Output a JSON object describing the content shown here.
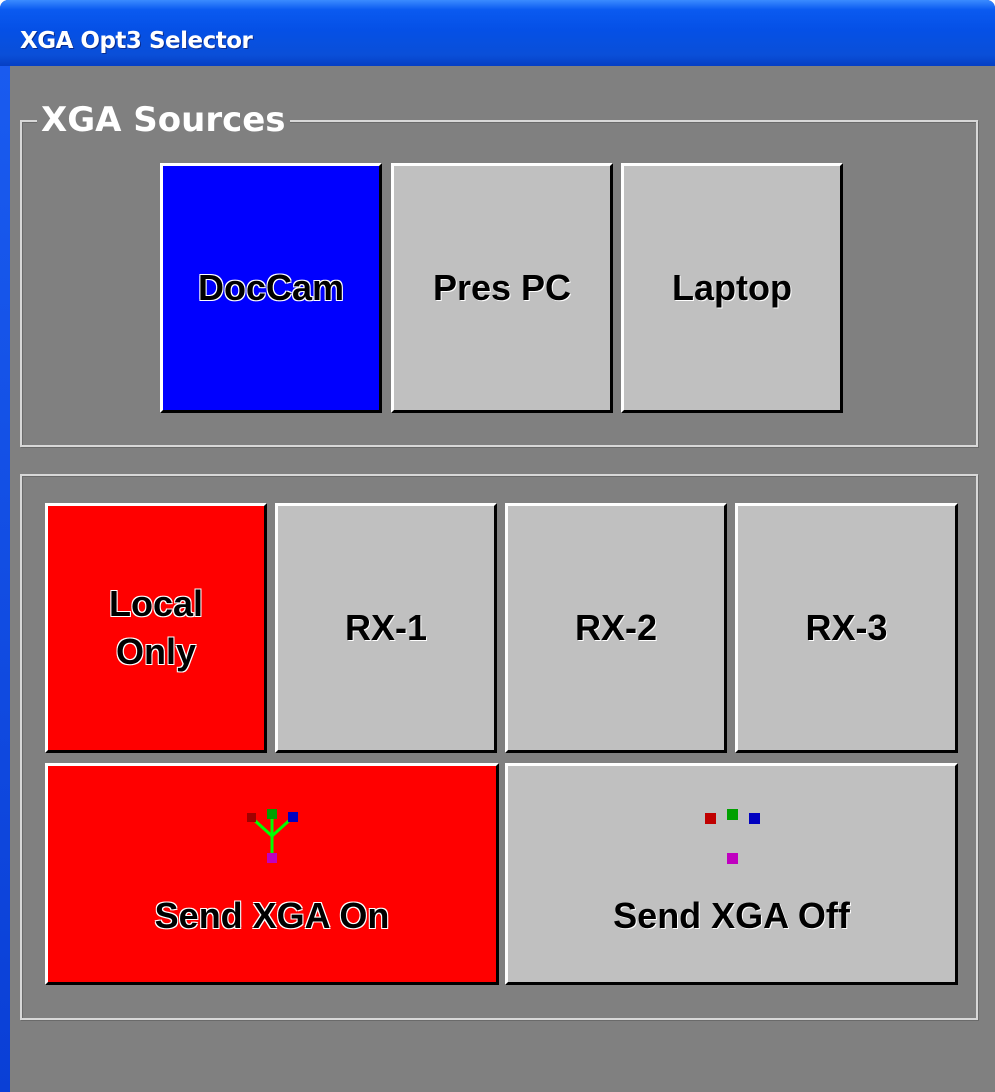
{
  "window": {
    "title": "XGA Opt3 Selector"
  },
  "sources": {
    "legend": "XGA Sources",
    "buttons": [
      {
        "label": "DocCam",
        "color": "#0000ff",
        "selected": true
      },
      {
        "label": "Pres PC",
        "color": "#c0c0c0",
        "selected": false
      },
      {
        "label": "Laptop",
        "color": "#c0c0c0",
        "selected": false
      }
    ]
  },
  "destinations": {
    "buttons": [
      {
        "label_line1": "Local",
        "label_line2": "Only",
        "color": "#ff0000",
        "selected": true
      },
      {
        "label": "RX-1",
        "color": "#c0c0c0",
        "selected": false
      },
      {
        "label": "RX-2",
        "color": "#c0c0c0",
        "selected": false
      },
      {
        "label": "RX-3",
        "color": "#c0c0c0",
        "selected": false
      }
    ],
    "send_on": {
      "label": "Send XGA On",
      "icon": "network-connected-icon",
      "color": "#ff0000",
      "selected": true
    },
    "send_off": {
      "label": "Send XGA Off",
      "icon": "network-disconnected-icon",
      "color": "#c0c0c0",
      "selected": false
    }
  }
}
